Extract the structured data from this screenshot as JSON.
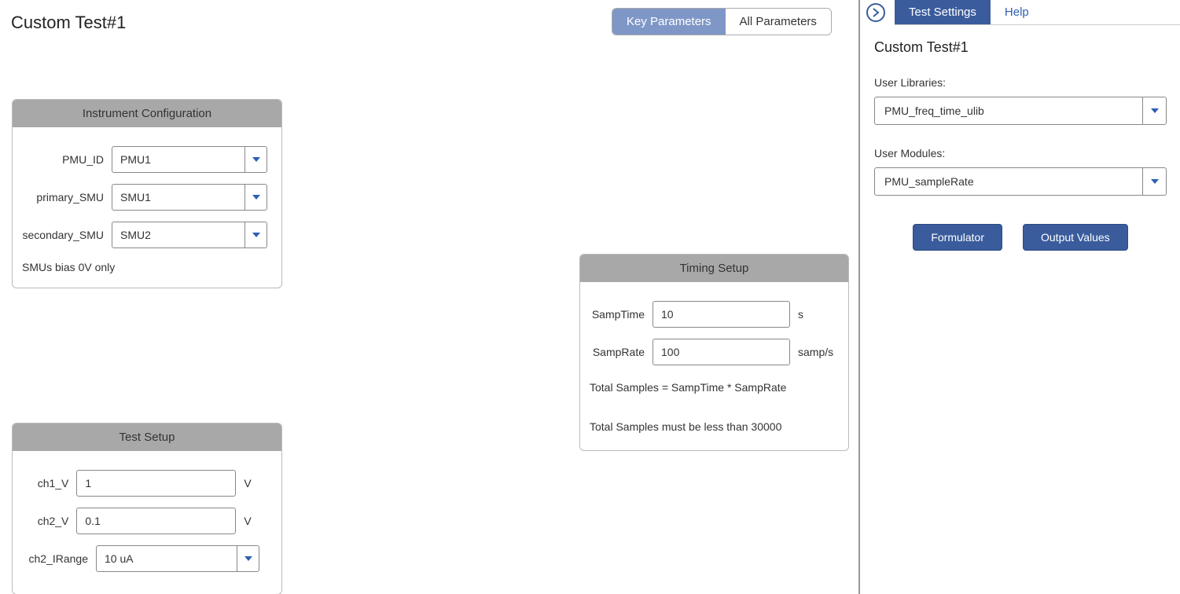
{
  "page_title": "Custom Test#1",
  "toggle": {
    "key": "Key Parameters",
    "all": "All Parameters"
  },
  "instr_panel": {
    "title": "Instrument Configuration",
    "rows": {
      "pmu_id": {
        "label": "PMU_ID",
        "value": "PMU1"
      },
      "primary_smu": {
        "label": "primary_SMU",
        "value": "SMU1"
      },
      "secondary_smu": {
        "label": "secondary_SMU",
        "value": "SMU2"
      }
    },
    "note": "SMUs bias 0V only"
  },
  "test_panel": {
    "title": "Test Setup",
    "rows": {
      "ch1_v": {
        "label": "ch1_V",
        "value": "1",
        "unit": "V"
      },
      "ch2_v": {
        "label": "ch2_V",
        "value": "0.1",
        "unit": "V"
      },
      "ch2_irange": {
        "label": "ch2_IRange",
        "value": "10 uA"
      }
    }
  },
  "timing_panel": {
    "title": "Timing Setup",
    "rows": {
      "samp_time": {
        "label": "SampTime",
        "value": "10",
        "unit": "s"
      },
      "samp_rate": {
        "label": "SampRate",
        "value": "100",
        "unit": "samp/s"
      }
    },
    "note1": "Total Samples = SampTime * SampRate",
    "note2": "Total Samples must be less than 30000"
  },
  "sidebar": {
    "tabs": {
      "settings": "Test Settings",
      "help": "Help"
    },
    "title": "Custom Test#1",
    "libs_label": "User Libraries:",
    "libs_value": "PMU_freq_time_ulib",
    "mods_label": "User Modules:",
    "mods_value": "PMU_sampleRate",
    "buttons": {
      "formulator": "Formulator",
      "output": "Output Values"
    }
  }
}
